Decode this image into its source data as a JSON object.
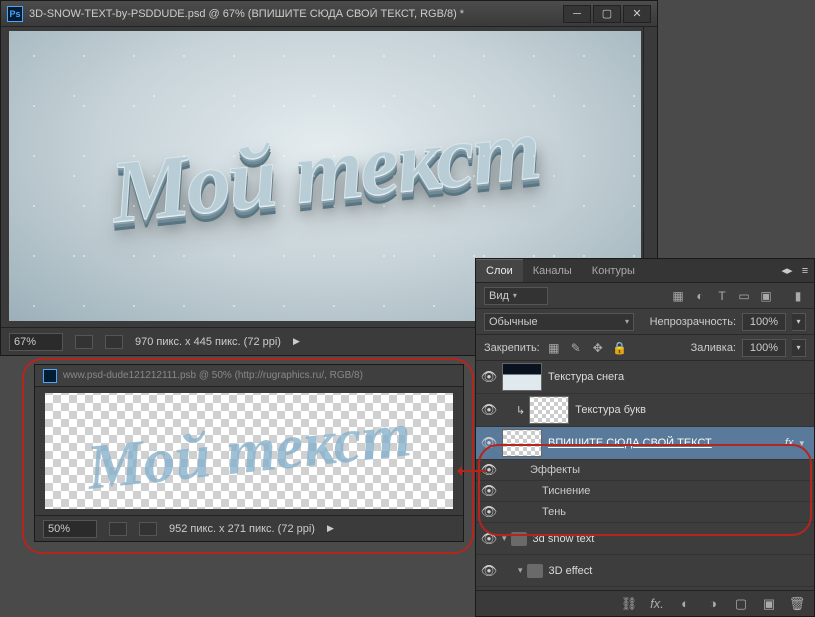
{
  "main": {
    "title": "3D-SNOW-TEXT-by-PSDDUDE.psd @ 67% (ВПИШИТЕ СЮДА СВОЙ ТЕКСТ, RGB/8) *",
    "canvas_text": "Мой текст",
    "status": {
      "zoom": "67%",
      "dims": "970 пикс. x 445 пикс. (72 ppi)"
    }
  },
  "tabwin": {
    "title": "www.psd-dude121212111.psb @ 50% (http://rugraphics.ru/, RGB/8)",
    "canvas_text": "Мой текст",
    "status": {
      "zoom": "50%",
      "dims": "952 пикс. x 271 пикс. (72 ppi)"
    }
  },
  "panel": {
    "tabs": [
      "Слои",
      "Каналы",
      "Контуры"
    ],
    "kind_label": "Вид",
    "blend_mode": "Обычные",
    "opacity_label": "Непрозрачность:",
    "opacity_value": "100%",
    "lock_label": "Закрепить:",
    "fill_label": "Заливка:",
    "fill_value": "100%",
    "layers": {
      "snow_texture": "Текстура снега",
      "letter_texture": "Текстура букв",
      "input_text": "ВПИШИТЕ СЮДА СВОЙ ТЕКСТ",
      "effects": "Эффекты",
      "emboss": "Тиснение",
      "shadow": "Тень",
      "group_3d_snow": "3d snow text",
      "group_3d_effect": "3D effect"
    },
    "fx_label": "fx",
    "footer_icons": {
      "link": "⛓",
      "fx": "fx.",
      "mask": "◐",
      "adjust": "◑",
      "group": "▢",
      "new": "▣",
      "trash": "🗑"
    }
  }
}
